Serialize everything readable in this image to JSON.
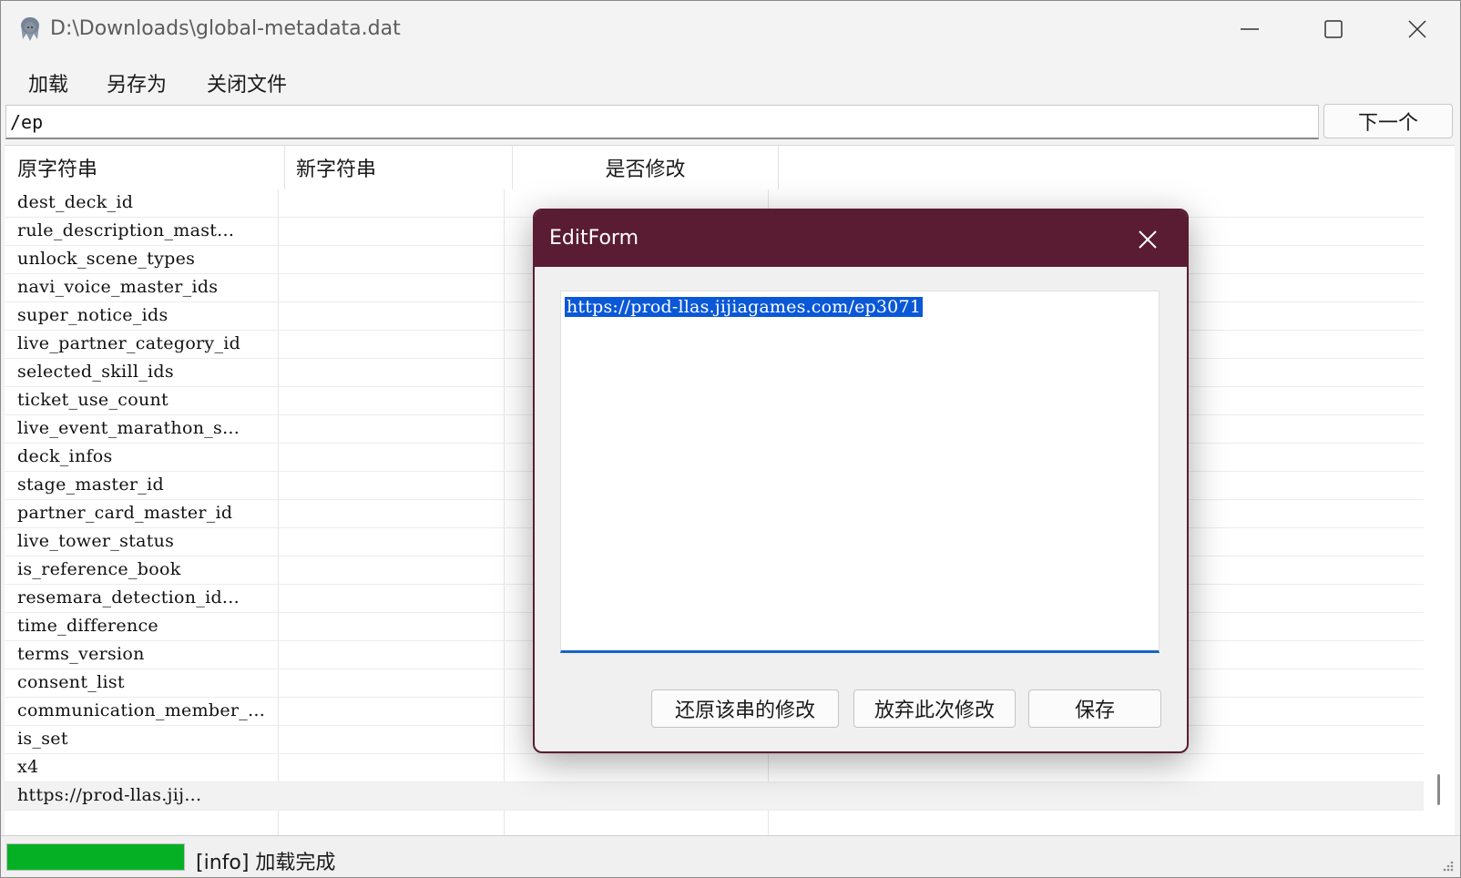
{
  "window": {
    "title": "D:\\Downloads\\global-metadata.dat"
  },
  "menu": {
    "items": [
      "加载",
      "另存为",
      "关闭文件"
    ]
  },
  "search": {
    "value": "/ep",
    "next_label": "下一个"
  },
  "list": {
    "headers": {
      "original": "原字符串",
      "new": "新字符串",
      "modified": "是否修改"
    },
    "rows": [
      "dest_deck_id",
      "rule_description_mast...",
      "unlock_scene_types",
      "navi_voice_master_ids",
      "super_notice_ids",
      "live_partner_category_id",
      "selected_skill_ids",
      "ticket_use_count",
      "live_event_marathon_s...",
      "deck_infos",
      "stage_master_id",
      "partner_card_master_id",
      "live_tower_status",
      "is_reference_book",
      "resemara_detection_id...",
      "time_difference",
      "terms_version",
      "consent_list",
      "communication_member_...",
      "is_set",
      "x4",
      "https://prod-llas.jij..."
    ]
  },
  "status": {
    "text": "[info] 加载完成",
    "progress_percent": 100,
    "progress_color": "#06b025"
  },
  "dialog": {
    "title": "EditForm",
    "text_value": "https://prod-llas.jijiagames.com/ep3071",
    "buttons": {
      "restore": "还原该串的修改",
      "discard": "放弃此次修改",
      "save": "保存"
    },
    "title_color": "#5a1c32"
  }
}
